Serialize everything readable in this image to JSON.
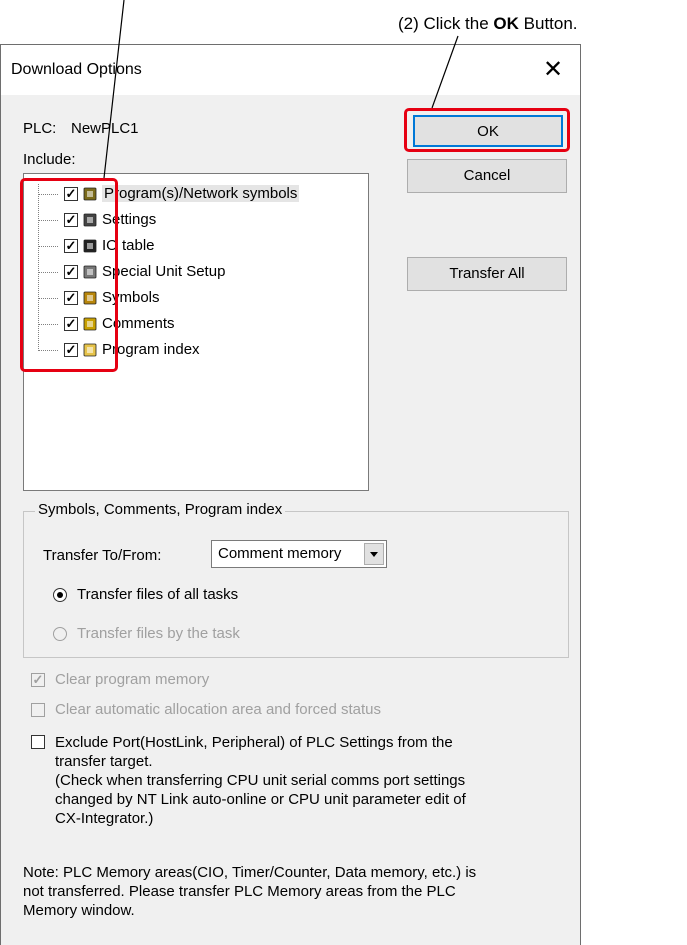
{
  "annotation": {
    "prefix": "(2) Click the ",
    "bold": "OK",
    "suffix": " Button."
  },
  "dialog": {
    "title": "Download Options",
    "close_glyph": "✕",
    "plc_label": "PLC:",
    "plc_name": "NewPLC1",
    "include_label": "Include:",
    "ok_label": "OK",
    "cancel_label": "Cancel",
    "transfer_all_label": "Transfer All",
    "tree_items": [
      {
        "label": "Program(s)/Network symbols",
        "icon": "program-icon",
        "checked": true
      },
      {
        "label": "Settings",
        "icon": "settings-icon",
        "checked": true
      },
      {
        "label": "IO table",
        "icon": "io-table-icon",
        "checked": true
      },
      {
        "label": "Special Unit Setup",
        "icon": "special-unit-icon",
        "checked": true
      },
      {
        "label": "Symbols",
        "icon": "symbols-icon",
        "checked": true
      },
      {
        "label": "Comments",
        "icon": "comments-icon",
        "checked": true
      },
      {
        "label": "Program index",
        "icon": "folder-icon",
        "checked": true
      }
    ],
    "group": {
      "legend": "Symbols, Comments, Program index",
      "transfer_label": "Transfer To/From:",
      "transfer_value": "Comment memory",
      "radio_all": "Transfer files of all tasks",
      "radio_task": "Transfer files by the task"
    },
    "clear_program_memory": "Clear program memory",
    "clear_auto_alloc": "Clear automatic allocation area and forced status",
    "exclude_port": {
      "line1": "Exclude Port(HostLink, Peripheral) of PLC Settings from the",
      "line2": "transfer target.",
      "line3": "(Check when transferring CPU unit serial comms port settings",
      "line4": "changed by NT Link auto-online or CPU unit parameter edit of",
      "line5": "CX-Integrator.)"
    },
    "note": {
      "line1": "Note: PLC Memory areas(CIO, Timer/Counter, Data memory, etc.) is",
      "line2": "not transferred. Please transfer PLC Memory areas from the PLC",
      "line3": "Memory window."
    }
  },
  "colors": {
    "highlight": "#e60012",
    "dialog_bg": "#f0f0f0"
  }
}
